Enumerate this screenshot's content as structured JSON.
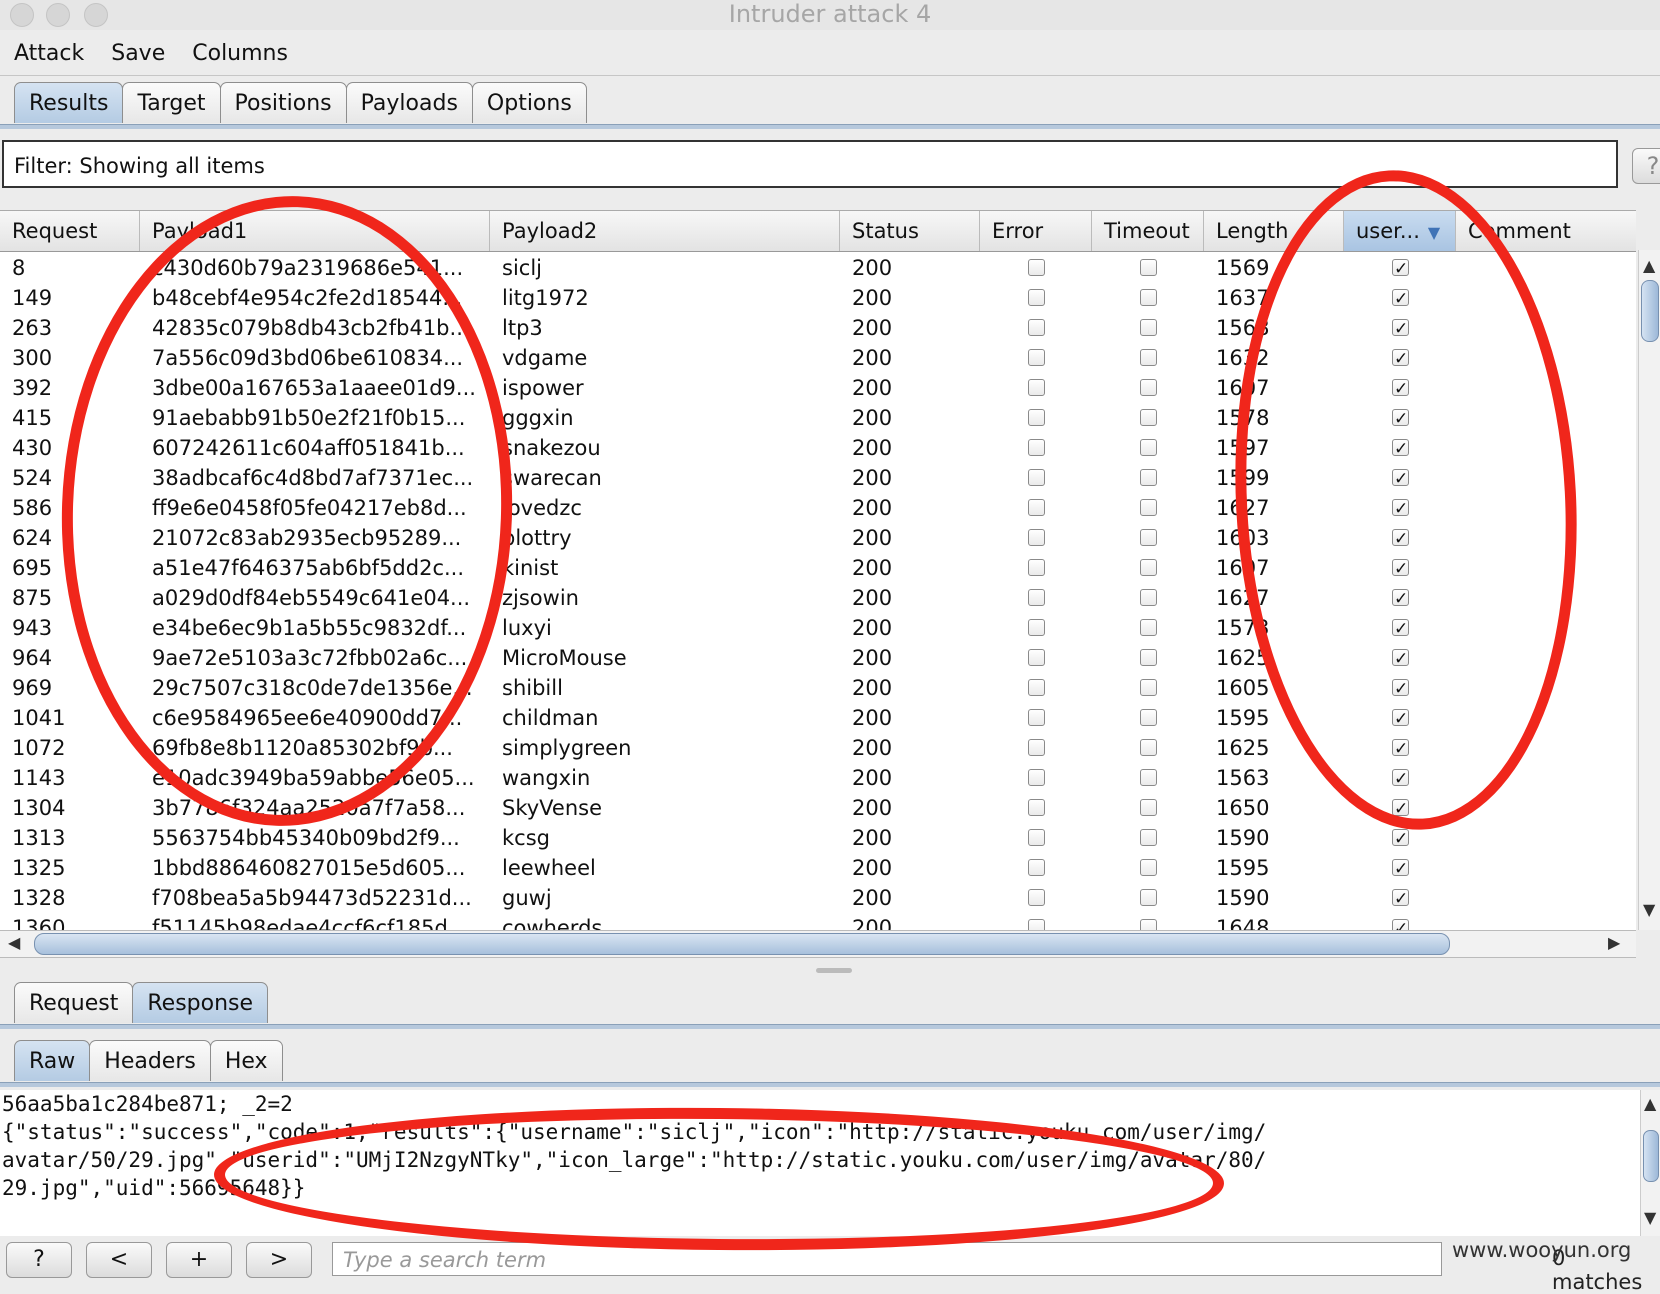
{
  "window": {
    "title": "Intruder attack 4"
  },
  "menu": [
    "Attack",
    "Save",
    "Columns"
  ],
  "main_tabs": [
    {
      "label": "Results",
      "active": true
    },
    {
      "label": "Target",
      "active": false
    },
    {
      "label": "Positions",
      "active": false
    },
    {
      "label": "Payloads",
      "active": false
    },
    {
      "label": "Options",
      "active": false
    }
  ],
  "filter": {
    "text": "Filter:  Showing all items",
    "help_label": "?"
  },
  "table": {
    "columns": [
      "Request",
      "Payload1",
      "Payload2",
      "Status",
      "Error",
      "Timeout",
      "Length",
      "user...",
      "Comment"
    ],
    "sorted_column": "user...",
    "rows": [
      {
        "request": "8",
        "payload1": "c430d60b79a2319686e541...",
        "payload2": "siclj",
        "status": "200",
        "error": false,
        "timeout": false,
        "length": "1569",
        "user": true
      },
      {
        "request": "149",
        "payload1": "b48cebf4e954c2fe2d18544...",
        "payload2": "litg1972",
        "status": "200",
        "error": false,
        "timeout": false,
        "length": "1637",
        "user": true
      },
      {
        "request": "263",
        "payload1": "42835c079b8db43cb2fb41b...",
        "payload2": "ltp3",
        "status": "200",
        "error": false,
        "timeout": false,
        "length": "1568",
        "user": true
      },
      {
        "request": "300",
        "payload1": "7a556c09d3bd06be610834...",
        "payload2": "vdgame",
        "status": "200",
        "error": false,
        "timeout": false,
        "length": "1632",
        "user": true
      },
      {
        "request": "392",
        "payload1": "3dbe00a167653a1aaee01d9...",
        "payload2": "ispower",
        "status": "200",
        "error": false,
        "timeout": false,
        "length": "1607",
        "user": true
      },
      {
        "request": "415",
        "payload1": "91aebabb91b50e2f21f0b15...",
        "payload2": "gggxin",
        "status": "200",
        "error": false,
        "timeout": false,
        "length": "1578",
        "user": true
      },
      {
        "request": "430",
        "payload1": "607242611c604aff051841b...",
        "payload2": "snakezou",
        "status": "200",
        "error": false,
        "timeout": false,
        "length": "1597",
        "user": true
      },
      {
        "request": "524",
        "payload1": "38adbcaf6c4d8bd7af7371ec...",
        "payload2": "swarecan",
        "status": "200",
        "error": false,
        "timeout": false,
        "length": "1599",
        "user": true
      },
      {
        "request": "586",
        "payload1": "ff9e6e0458f05fe04217eb8d...",
        "payload2": "lovedzc",
        "status": "200",
        "error": false,
        "timeout": false,
        "length": "1627",
        "user": true
      },
      {
        "request": "624",
        "payload1": "21072c83ab2935ecb95289...",
        "payload2": "blottry",
        "status": "200",
        "error": false,
        "timeout": false,
        "length": "1603",
        "user": true
      },
      {
        "request": "695",
        "payload1": "a51e47f646375ab6bf5dd2c...",
        "payload2": "kinist",
        "status": "200",
        "error": false,
        "timeout": false,
        "length": "1607",
        "user": true
      },
      {
        "request": "875",
        "payload1": "a029d0df84eb5549c641e04...",
        "payload2": "zjsowin",
        "status": "200",
        "error": false,
        "timeout": false,
        "length": "1627",
        "user": true
      },
      {
        "request": "943",
        "payload1": "e34be6ec9b1a5b55c9832df...",
        "payload2": "luxyi",
        "status": "200",
        "error": false,
        "timeout": false,
        "length": "1573",
        "user": true
      },
      {
        "request": "964",
        "payload1": "9ae72e5103a3c72fbb02a6c...",
        "payload2": "MicroMouse",
        "status": "200",
        "error": false,
        "timeout": false,
        "length": "1625",
        "user": true
      },
      {
        "request": "969",
        "payload1": "29c7507c318c0de7de1356e...",
        "payload2": "shibill",
        "status": "200",
        "error": false,
        "timeout": false,
        "length": "1605",
        "user": true
      },
      {
        "request": "1041",
        "payload1": "c6e9584965ee6e40900dd7...",
        "payload2": "childman",
        "status": "200",
        "error": false,
        "timeout": false,
        "length": "1595",
        "user": true
      },
      {
        "request": "1072",
        "payload1": "69fb8e8b1120a85302bf9b...",
        "payload2": "simplygreen",
        "status": "200",
        "error": false,
        "timeout": false,
        "length": "1625",
        "user": true
      },
      {
        "request": "1143",
        "payload1": "e10adc3949ba59abbe56e05...",
        "payload2": "wangxin",
        "status": "200",
        "error": false,
        "timeout": false,
        "length": "1563",
        "user": true
      },
      {
        "request": "1304",
        "payload1": "3b7786f324aa2520a7f7a58...",
        "payload2": "SkyVense",
        "status": "200",
        "error": false,
        "timeout": false,
        "length": "1650",
        "user": true
      },
      {
        "request": "1313",
        "payload1": "5563754bb45340b09bd2f9...",
        "payload2": "kcsg",
        "status": "200",
        "error": false,
        "timeout": false,
        "length": "1590",
        "user": true
      },
      {
        "request": "1325",
        "payload1": "1bbd886460827015e5d605...",
        "payload2": "leewheel",
        "status": "200",
        "error": false,
        "timeout": false,
        "length": "1595",
        "user": true
      },
      {
        "request": "1328",
        "payload1": "f708bea5a5b94473d52231d...",
        "payload2": "guwj",
        "status": "200",
        "error": false,
        "timeout": false,
        "length": "1590",
        "user": true
      },
      {
        "request": "1360",
        "payload1": "f51145b98edae4ccf6cf185d...",
        "payload2": "cowherds",
        "status": "200",
        "error": false,
        "timeout": false,
        "length": "1648",
        "user": true
      }
    ]
  },
  "detail_tabs": [
    {
      "label": "Request",
      "active": false
    },
    {
      "label": "Response",
      "active": true
    }
  ],
  "view_tabs": [
    {
      "label": "Raw",
      "active": true
    },
    {
      "label": "Headers",
      "active": false
    },
    {
      "label": "Hex",
      "active": false
    }
  ],
  "response_lines": [
    "56aa5ba1c284be871; _2=2",
    "",
    "{\"status\":\"success\",\"code\":1,\"results\":{\"username\":\"siclj\",\"icon\":\"http://static.youku.com/user/img/",
    "avatar/50/29.jpg\",\"userid\":\"UMjI2NzgyNTky\",\"icon_large\":\"http://static.youku.com/user/img/avatar/80/",
    "29.jpg\",\"uid\":56695648}}"
  ],
  "bottom_bar": {
    "help": "?",
    "prev": "<",
    "add": "+",
    "next": ">",
    "search_placeholder": "Type a search term",
    "matches": "0 matches",
    "watermark": "www.wooyun.org"
  },
  "annotation_color": "#f0261b"
}
